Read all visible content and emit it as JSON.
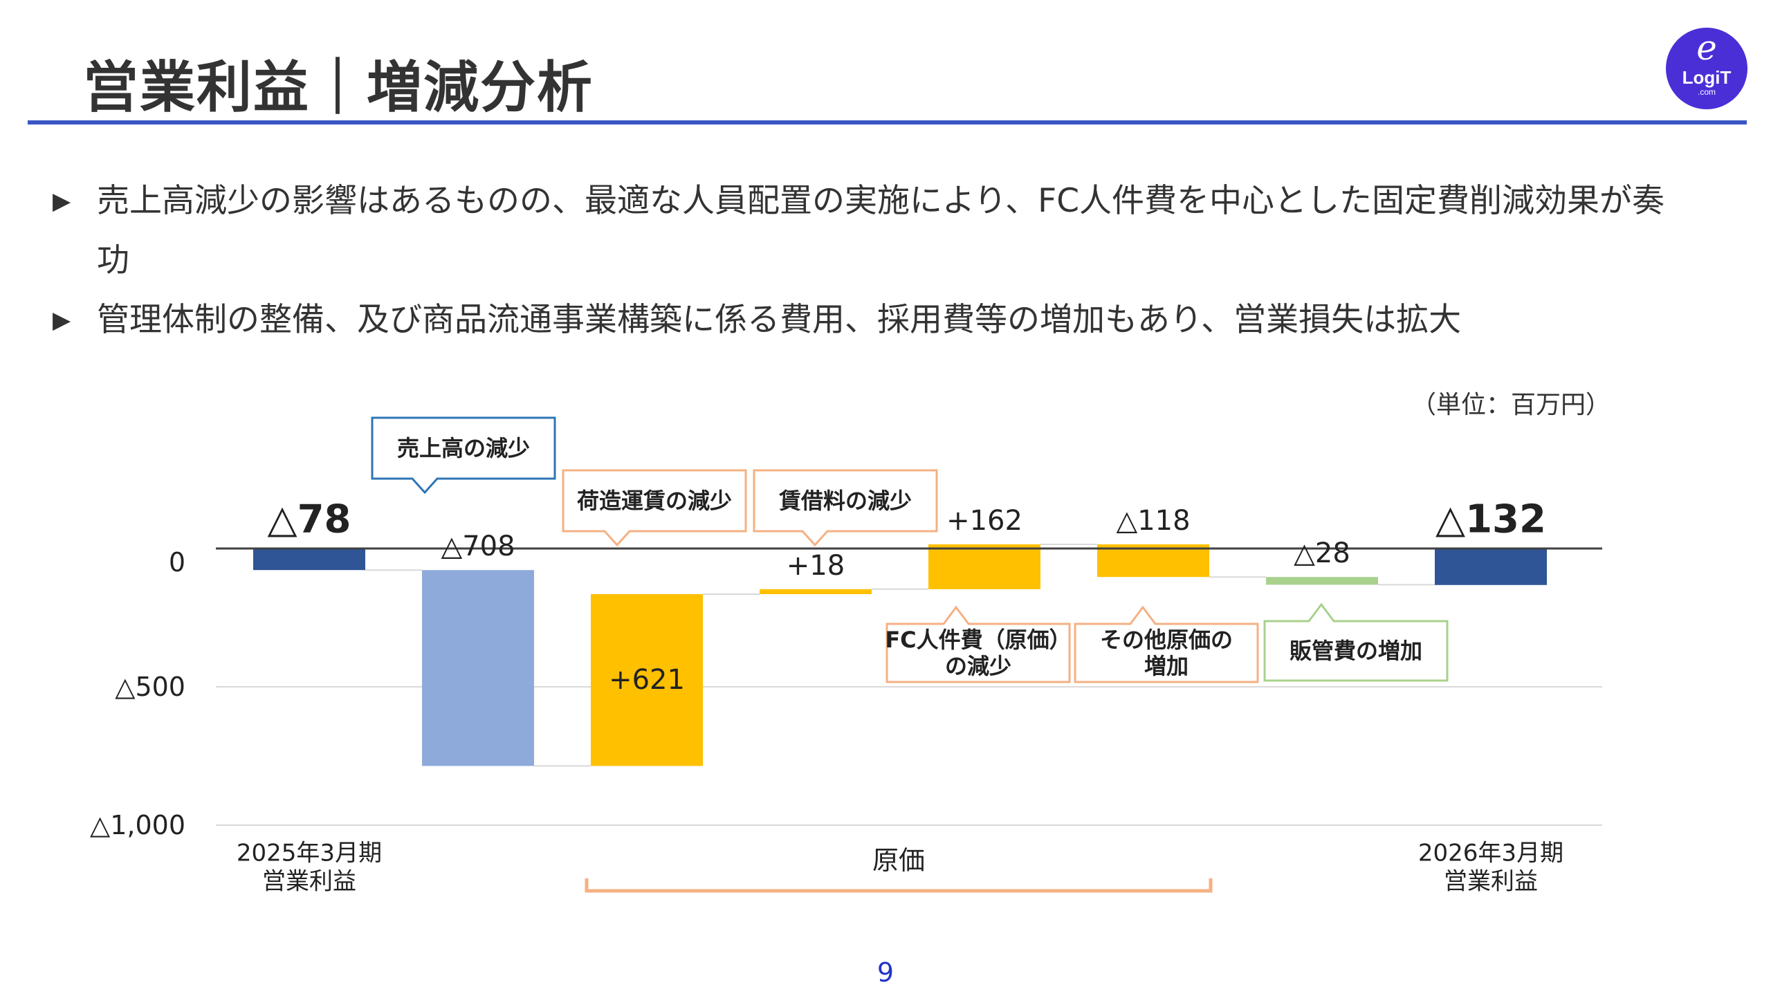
{
  "slide": {
    "title": "営業利益｜増減分析",
    "bullets": [
      "売上高減少の影響はあるものの、最適な人員配置の実施により、FC人件費を中心とした固定費削減効果が奏功",
      "管理体制の整備、及び商品流通事業構築に係る費用、採用費等の増加もあり、営業損失は拡大"
    ],
    "bullet_marker": "▶",
    "unit_note": "（単位：百万円）",
    "page_number": "9"
  },
  "logo": {
    "script": "e",
    "name": "LogiT",
    "domain": ".com"
  },
  "chart_data": {
    "type": "waterfall",
    "y_axis": {
      "ticks": [
        0,
        -500,
        -1000
      ],
      "tick_labels": [
        "0",
        "△500",
        "△1,000"
      ],
      "ylim": [
        -1000,
        0
      ],
      "gridlines": true
    },
    "steps": [
      {
        "kind": "total",
        "category": "2025年3月期\n営業利益",
        "value": -78,
        "label": "△78",
        "color": "#2f5597"
      },
      {
        "kind": "delta",
        "value": -708,
        "label": "△708",
        "color": "#8eaadb",
        "note": "売上高の減少",
        "note_color": "#2e75b6"
      },
      {
        "kind": "delta",
        "value": 621,
        "label": "+621",
        "color": "#ffc000",
        "note": "荷造運賃の減少",
        "note_color": "#f4b183"
      },
      {
        "kind": "delta",
        "value": 18,
        "label": "+18",
        "color": "#ffc000",
        "note": "賃借料の減少",
        "note_color": "#f4b183"
      },
      {
        "kind": "delta",
        "value": 162,
        "label": "+162",
        "color": "#ffc000",
        "note": "FC人件費（原価）\nの減少",
        "note_color": "#f4b183"
      },
      {
        "kind": "delta",
        "value": -118,
        "label": "△118",
        "color": "#ffc000",
        "note": "その他原価の\n増加",
        "note_color": "#f4b183"
      },
      {
        "kind": "delta",
        "value": -28,
        "label": "△28",
        "color": "#a9d18e",
        "note": "販管費の増加",
        "note_color": "#a9d18e"
      },
      {
        "kind": "total",
        "category": "2026年3月期\n営業利益",
        "value": -132,
        "label": "△132",
        "color": "#2f5597"
      }
    ],
    "group_bracket": {
      "label": "原価",
      "from_step": 2,
      "to_step": 5,
      "color": "#f4b183"
    }
  }
}
